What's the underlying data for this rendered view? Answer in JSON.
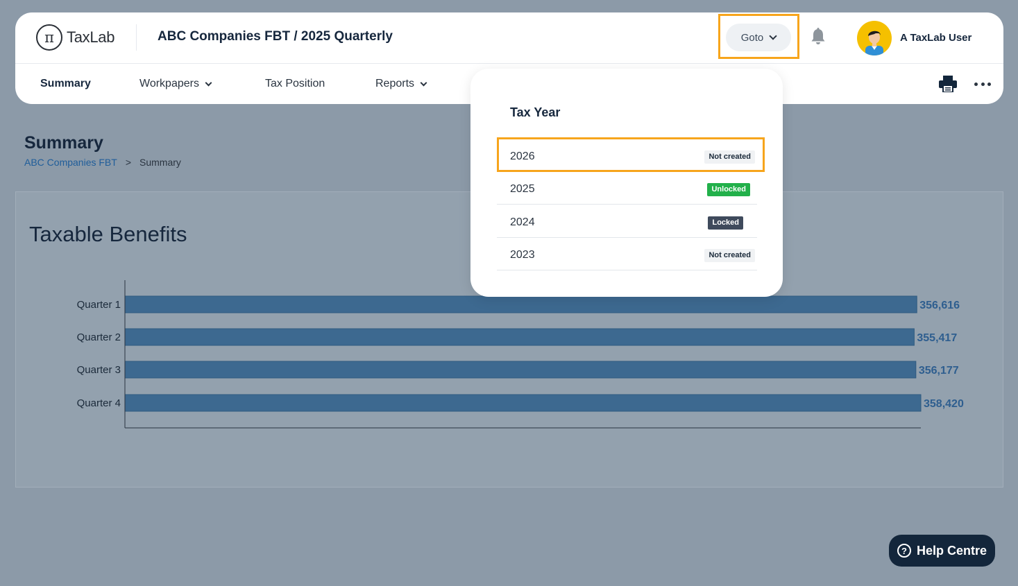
{
  "header": {
    "logo_glyph": "π",
    "logo_text": "TaxLab",
    "page_title": "ABC Companies FBT / 2025 Quarterly",
    "goto_label": "Goto",
    "user_name": "A TaxLab User",
    "highlight_color": "#f7a51c"
  },
  "nav": {
    "items": [
      {
        "label": "Summary",
        "active": true
      },
      {
        "label": "Workpapers",
        "has_menu": true
      },
      {
        "label": "Tax Position"
      },
      {
        "label": "Reports",
        "has_menu": true
      }
    ]
  },
  "page": {
    "heading": "Summary",
    "breadcrumb": {
      "link": "ABC Companies FBT",
      "separator": ">",
      "current": "Summary"
    }
  },
  "chart": {
    "title": "Taxable Benefits"
  },
  "chart_data": {
    "type": "bar",
    "orientation": "horizontal",
    "categories": [
      "Quarter 1",
      "Quarter 2",
      "Quarter 3",
      "Quarter 4"
    ],
    "values": [
      356616,
      355417,
      356177,
      358420
    ],
    "value_labels": [
      "356,616",
      "355,417",
      "356,177",
      "358,420"
    ],
    "xlim": [
      0,
      358420
    ],
    "bar_color": "#3d6990",
    "label_color": "#2e5e8f",
    "grid": false
  },
  "dropdown": {
    "title": "Tax Year",
    "years": [
      {
        "year": "2026",
        "status": "Not created",
        "style": "gray"
      },
      {
        "year": "2025",
        "status": "Unlocked",
        "style": "green"
      },
      {
        "year": "2024",
        "status": "Locked",
        "style": "dark"
      },
      {
        "year": "2023",
        "status": "Not created",
        "style": "gray"
      }
    ]
  },
  "help": {
    "icon": "?",
    "label": "Help Centre"
  }
}
